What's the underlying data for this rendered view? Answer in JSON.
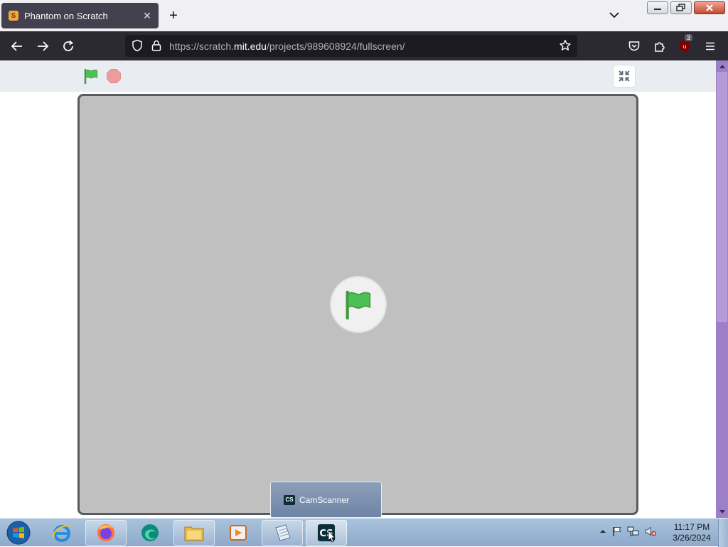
{
  "browser": {
    "tab": {
      "title": "Phantom on Scratch",
      "favicon": "scratch-cat-icon",
      "close_glyph": "✕"
    },
    "new_tab_glyph": "+",
    "url": {
      "prefix": "https://scratch.",
      "domain": "mit.edu",
      "path": "/projects/989608924/fullscreen/"
    },
    "extensions_badge": "3"
  },
  "scratch": {
    "menu": {
      "green_flag": "green-flag-icon",
      "stop": "stop-icon",
      "exit_fullscreen": "unfullscreen-icon"
    },
    "stage": {
      "overlay": "green-flag-icon"
    }
  },
  "taskbar": {
    "apps": [
      "windows-start",
      "internet-explorer",
      "firefox",
      "edge",
      "file-explorer",
      "media-player",
      "notepad",
      "camscanner"
    ],
    "popup": {
      "label": "CamScanner",
      "icon_text": "CS"
    },
    "clock": {
      "time": "11:17 PM",
      "date": "3/26/2024"
    }
  },
  "colors": {
    "accent_green": "#4cae4c",
    "stage_bg": "#c0c0c0",
    "stop_red": "#ec9c9c",
    "scrollbar": "#9c7fc6"
  }
}
